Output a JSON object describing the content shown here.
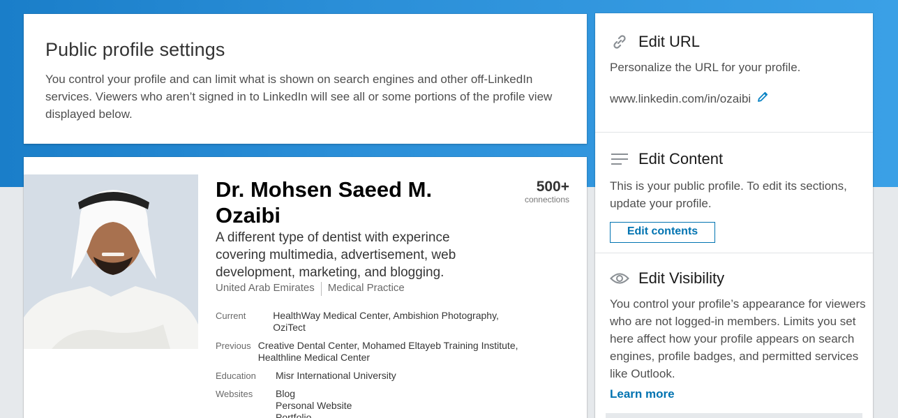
{
  "intro": {
    "title": "Public profile settings",
    "description": "You control your profile and can limit what is shown on search engines and other off-LinkedIn services. Viewers who aren’t signed in to LinkedIn will see all or some portions of the profile view displayed below."
  },
  "profile": {
    "name": "Dr. Mohsen Saeed M. Ozaibi",
    "headline": "A different type of dentist with experince covering multimedia, advertisement, web development, marketing, and blogging.",
    "location": "United Arab Emirates",
    "industry": "Medical Practice",
    "connections_count": "500+",
    "connections_label": "connections",
    "facts": [
      {
        "label": "Current",
        "value": "HealthWay Medical Center, Ambishion Photography, OziTect"
      },
      {
        "label": "Previous",
        "value": "Creative Dental Center, Mohamed Eltayeb Training Institute, Healthline Medical Center"
      },
      {
        "label": "Education",
        "value": "Misr International University"
      },
      {
        "label": "Websites",
        "value": "Blog\nPersonal Website\nPortfolio"
      }
    ]
  },
  "edit_url": {
    "title": "Edit URL",
    "icon": "link-icon",
    "description": "Personalize the URL for your profile.",
    "url": "www.linkedin.com/in/ozaibi",
    "edit_icon": "pencil-icon"
  },
  "edit_content": {
    "title": "Edit Content",
    "icon": "lines-icon",
    "description": "This is your public profile. To edit its sections, update your profile.",
    "button_label": "Edit contents"
  },
  "edit_visibility": {
    "title": "Edit Visibility",
    "icon": "eye-icon",
    "description": "You control your profile’s appearance for viewers who are not logged-in members. Limits you set here affect how your profile appears on search engines, profile badges, and permitted services like Outlook.",
    "learn_more": "Learn more"
  },
  "colors": {
    "accent": "#0073b1",
    "hero": "#2b8fd8",
    "background": "#e6e9ec"
  }
}
